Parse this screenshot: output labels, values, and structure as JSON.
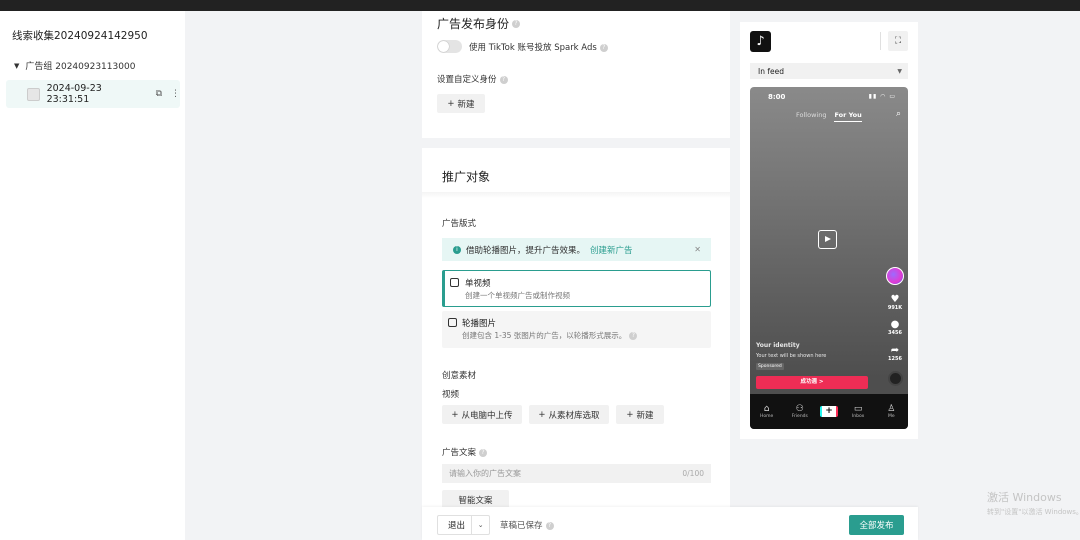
{
  "sidebar": {
    "campaign_name": "线索收集20240924142950",
    "adgroup_name": "广告组 20240923113000",
    "ad_name": "2024-09-23 23:31:51"
  },
  "identity_card": {
    "title": "广告发布身份",
    "spark_ads_label": "使用 TikTok 账号投放 Spark Ads",
    "custom_identity_label": "设置自定义身份",
    "new_button": "新建"
  },
  "promo_card": {
    "title": "推广对象",
    "ad_format_label": "广告版式",
    "info_text": "借助轮播图片，提升广告效果。",
    "info_link": "创建新广告",
    "options": [
      {
        "title": "单视频",
        "desc": "创建一个单视频广告或制作视频",
        "selected": true
      },
      {
        "title": "轮播图片",
        "desc": "创建包含 1-35 张图片的广告，以轮播形式展示。",
        "selected": false
      }
    ],
    "creative_label": "创意素材",
    "video_label": "视频",
    "upload_buttons": [
      "从电脑中上传",
      "从素材库选取",
      "新建"
    ],
    "ad_text_label": "广告文案",
    "ad_text_placeholder": "请输入你的广告文案",
    "ad_text_counter": "0/100",
    "smart_text_button": "智能文案"
  },
  "footer": {
    "exit_label": "退出",
    "saved_label": "草稿已保存",
    "publish_label": "全部发布"
  },
  "preview": {
    "placement": "In feed",
    "phone": {
      "time": "8:00",
      "tab_following": "Following",
      "tab_for_you": "For You",
      "likes": "991K",
      "comments": "3456",
      "shares": "1256",
      "identity": "Your identity",
      "text": "Your text will be shown here",
      "sponsored": "Sponsored",
      "cta": "成功週 >",
      "nav": [
        "Home",
        "Friends",
        "",
        "Inbox",
        "Me"
      ]
    }
  },
  "watermark": {
    "line1": "激活 Windows",
    "line2": "转到\"设置\"以激活 Windows。"
  },
  "colors": {
    "accent": "#2a9d8f",
    "cta": "#ee2d55"
  }
}
